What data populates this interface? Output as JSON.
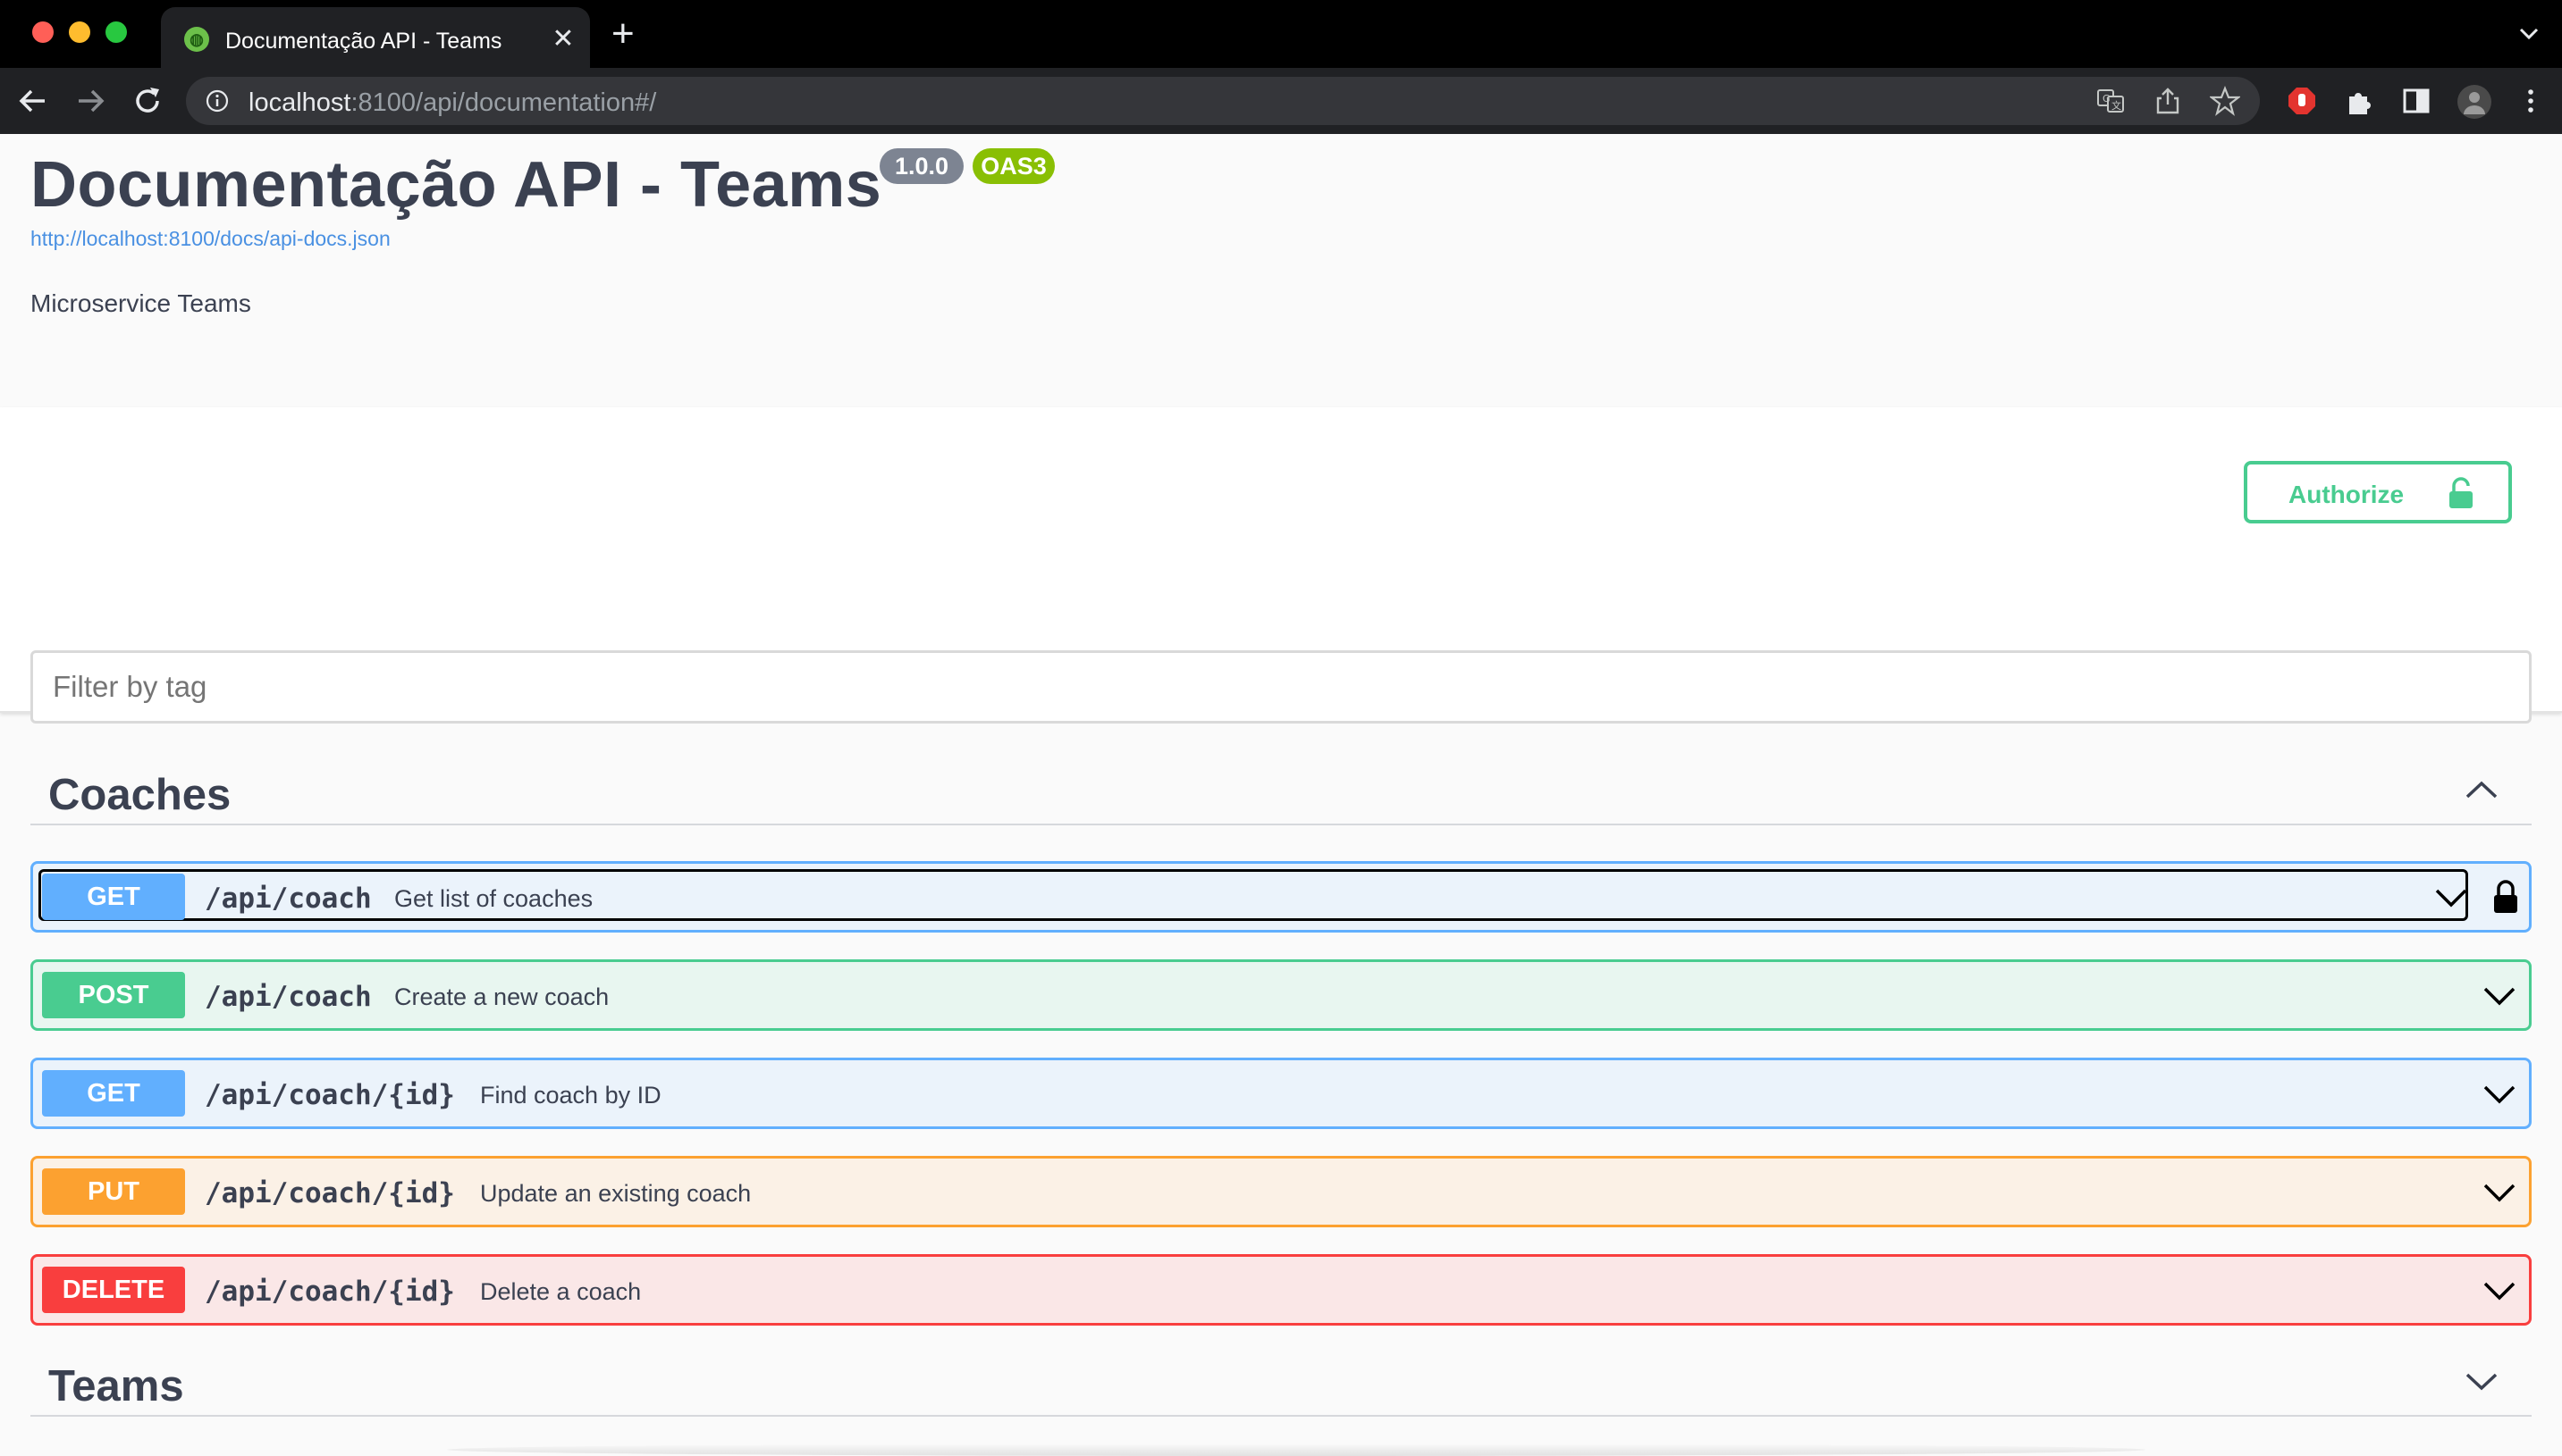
{
  "browser": {
    "tab_title": "Documentação API - Teams",
    "tab_close": "✕",
    "new_tab": "+",
    "url_host": "localhost",
    "url_rest": ":8100/api/documentation#/"
  },
  "info": {
    "title": "Documentação API - Teams",
    "version_badge": "1.0.0",
    "oas_badge": "OAS3",
    "spec_link": "http://localhost:8100/docs/api-docs.json",
    "description": "Microservice Teams"
  },
  "authorize": {
    "label": "Authorize"
  },
  "filter": {
    "placeholder": "Filter by tag"
  },
  "tags": [
    {
      "name": "Coaches",
      "expanded": true,
      "operations": [
        {
          "method": "GET",
          "path": "/api/coach",
          "summary": "Get list of coaches",
          "focused": true,
          "locked": true
        },
        {
          "method": "POST",
          "path": "/api/coach",
          "summary": "Create a new coach"
        },
        {
          "method": "GET",
          "path": "/api/coach/{id}",
          "summary": "Find coach by ID"
        },
        {
          "method": "PUT",
          "path": "/api/coach/{id}",
          "summary": "Update an existing coach"
        },
        {
          "method": "DELETE",
          "path": "/api/coach/{id}",
          "summary": "Delete a coach"
        }
      ]
    },
    {
      "name": "Teams",
      "expanded": false
    }
  ],
  "colors": {
    "get": "#61affe",
    "post": "#49cc90",
    "put": "#fca130",
    "delete": "#f93e3e",
    "text": "#3b4151",
    "link": "#4990e2"
  }
}
